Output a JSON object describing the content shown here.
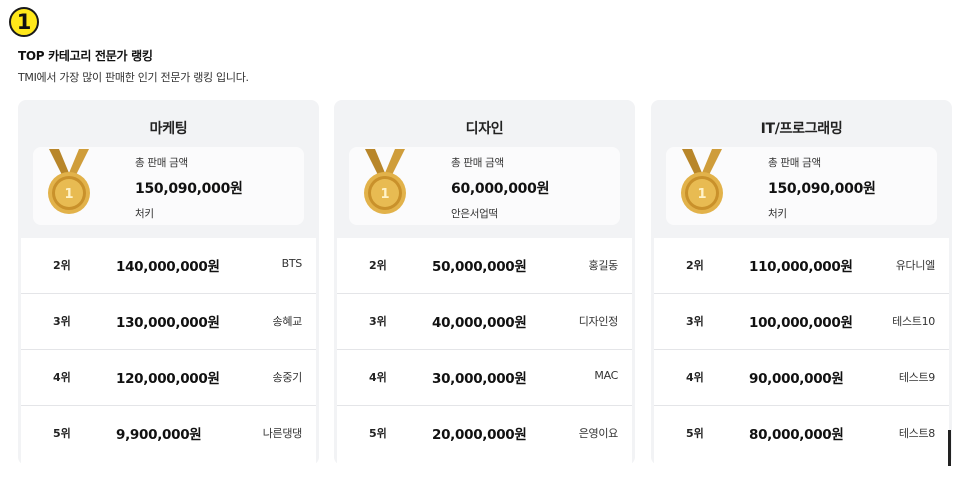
{
  "marker": "1",
  "header": {
    "title": "TOP 카테고리 전문가 랭킹",
    "subtitle": "TMI에서 가장 많이 판매한 인기 전문가 랭킹 입니다."
  },
  "colors": {
    "card_bg": "#f2f3f5",
    "marker_yellow": "#ffe81a",
    "medal_gold": "#d9a53a"
  },
  "icons": {
    "medal": "gold-medal-icon"
  },
  "categories": [
    {
      "title": "마케팅",
      "top": {
        "label": "총 판매 금액",
        "amount": "150,090,000원",
        "name": "처키",
        "medal_number": "1"
      },
      "ranks": [
        {
          "rank": "2위",
          "amount": "140,000,000원",
          "name": "BTS"
        },
        {
          "rank": "3위",
          "amount": "130,000,000원",
          "name": "송혜교"
        },
        {
          "rank": "4위",
          "amount": "120,000,000원",
          "name": "송중기"
        },
        {
          "rank": "5위",
          "amount": "9,900,000원",
          "name": "나른댕댕"
        }
      ]
    },
    {
      "title": "디자인",
      "top": {
        "label": "총 판매 금액",
        "amount": "60,000,000원",
        "name": "안은서업떡",
        "medal_number": "1"
      },
      "ranks": [
        {
          "rank": "2위",
          "amount": "50,000,000원",
          "name": "홍길동"
        },
        {
          "rank": "3위",
          "amount": "40,000,000원",
          "name": "디자인정"
        },
        {
          "rank": "4위",
          "amount": "30,000,000원",
          "name": "MAC"
        },
        {
          "rank": "5위",
          "amount": "20,000,000원",
          "name": "은영이요"
        }
      ]
    },
    {
      "title": "IT/프로그래밍",
      "top": {
        "label": "총 판매 금액",
        "amount": "150,090,000원",
        "name": "처키",
        "medal_number": "1"
      },
      "ranks": [
        {
          "rank": "2위",
          "amount": "110,000,000원",
          "name": "유다니엘"
        },
        {
          "rank": "3위",
          "amount": "100,000,000원",
          "name": "테스트10"
        },
        {
          "rank": "4위",
          "amount": "90,000,000원",
          "name": "테스트9"
        },
        {
          "rank": "5위",
          "amount": "80,000,000원",
          "name": "테스트8"
        }
      ]
    }
  ]
}
